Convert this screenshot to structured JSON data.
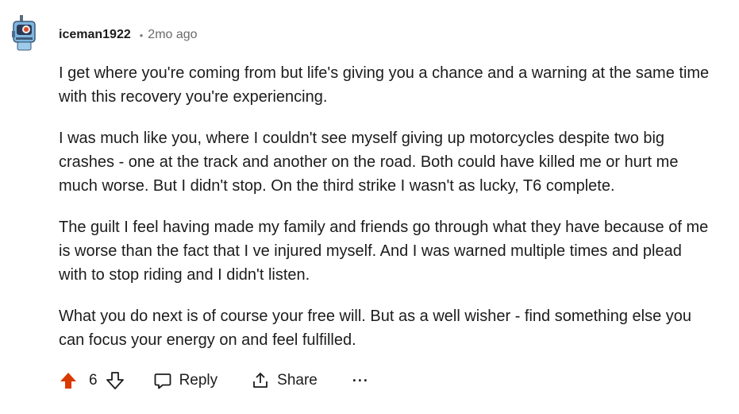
{
  "comment": {
    "username": "iceman1922",
    "separator": "•",
    "time_ago": "2mo ago",
    "paragraphs": [
      "I get where you're coming from but life's giving you a chance and a warning at the same time with this recovery you're experiencing.",
      "I was much like you, where I couldn't see myself giving up motorcycles despite two big crashes - one at the track and another on the road. Both could have killed me or hurt me much worse. But I didn't stop. On the third strike I wasn't as lucky, T6 complete.",
      "The guilt I feel having made my family and friends go through what they have because of me is worse than the fact that I ve injured myself. And I was warned multiple times and plead with to stop riding and I didn't listen.",
      "What you do next is of course your free will. But as a well wisher - find something else you can focus your energy on and feel fulfilled."
    ]
  },
  "actions": {
    "vote_count": "6",
    "reply_label": "Reply",
    "share_label": "Share",
    "more_label": "···"
  },
  "icons": {
    "upvote": "upvote-arrow-icon",
    "downvote": "downvote-arrow-icon",
    "reply": "speech-bubble-icon",
    "share": "share-upload-icon",
    "more": "ellipsis-icon",
    "avatar": "robot-avatar"
  },
  "colors": {
    "upvote_active": "#d93a00",
    "text": "#1c1c1c",
    "muted": "#6a6a6a"
  }
}
